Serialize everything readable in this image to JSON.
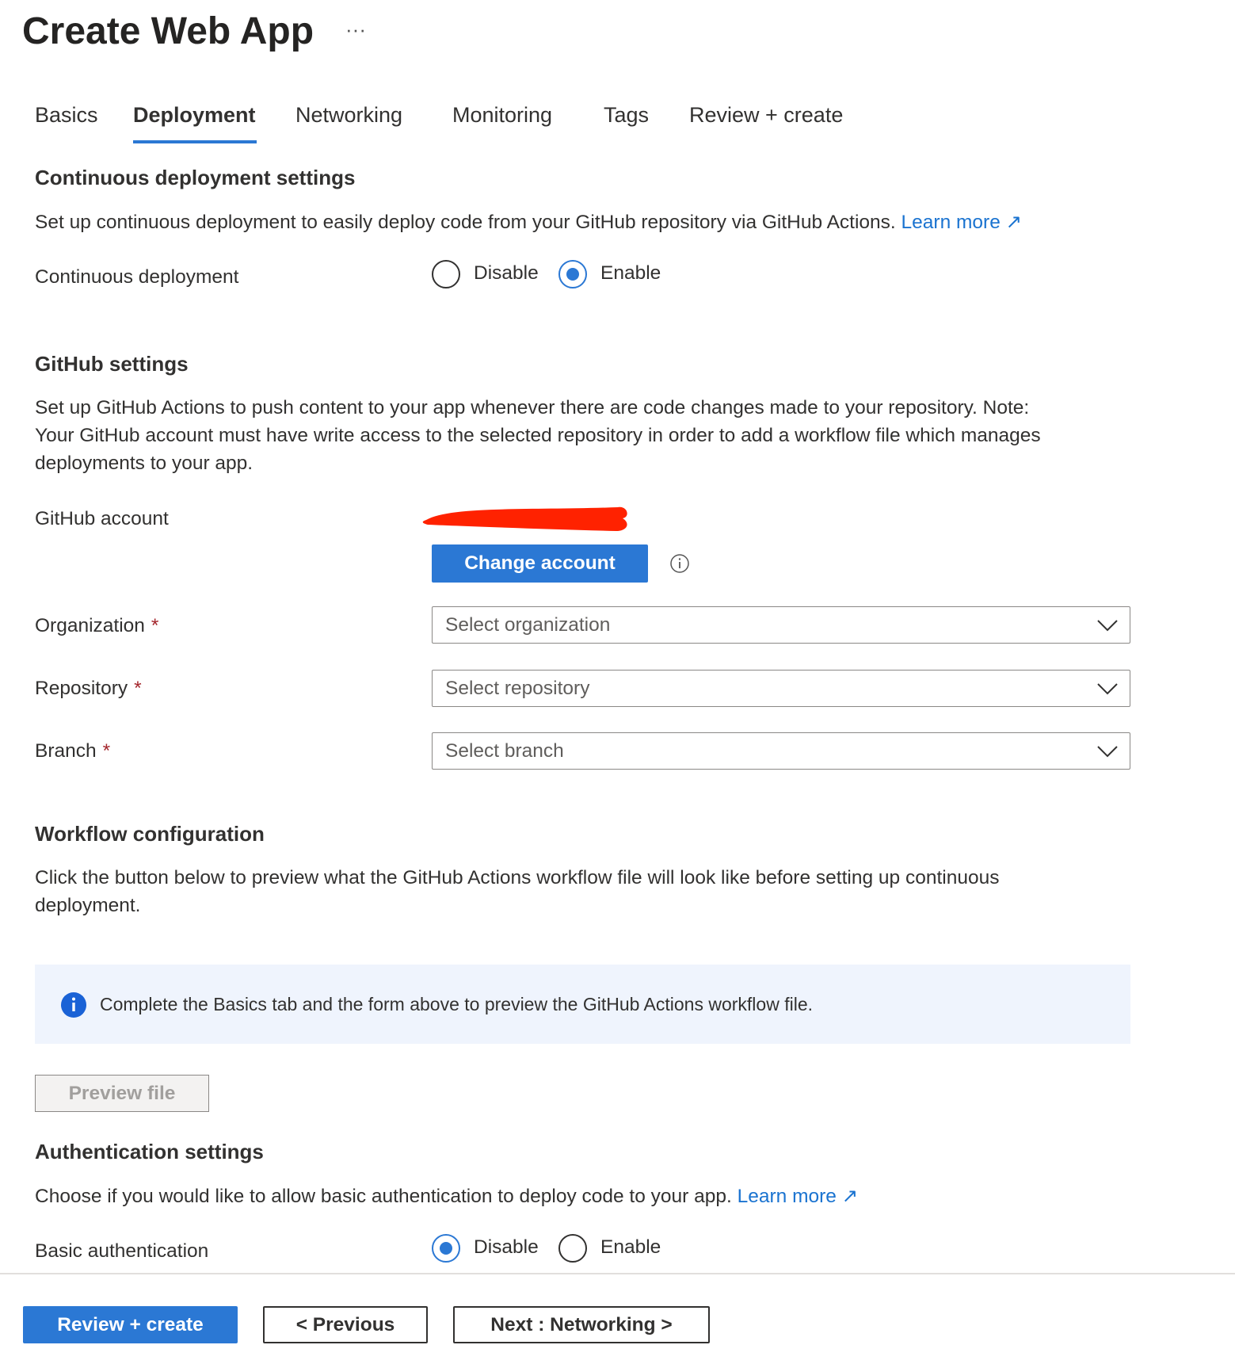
{
  "header": {
    "title": "Create Web App",
    "more": "···"
  },
  "tabs": [
    {
      "label": "Basics"
    },
    {
      "label": "Deployment"
    },
    {
      "label": "Networking"
    },
    {
      "label": "Monitoring"
    },
    {
      "label": "Tags"
    },
    {
      "label": "Review + create"
    }
  ],
  "cd": {
    "heading": "Continuous deployment settings",
    "description": "Set up continuous deployment to easily deploy code from your GitHub repository via GitHub Actions.",
    "learn_more": "Learn more",
    "label": "Continuous deployment",
    "options": [
      "Disable",
      "Enable"
    ],
    "selected": "Enable"
  },
  "github": {
    "heading": "GitHub settings",
    "description_lines": [
      "Set up GitHub Actions to push content to your app whenever there are code changes made to your repository. Note:",
      "Your GitHub account must have write access to the selected repository in order to add a workflow file which manages",
      "deployments to your app."
    ],
    "account_label": "GitHub account",
    "change_account": "Change account",
    "organization": {
      "label": "Organization",
      "placeholder": "Select organization"
    },
    "repository": {
      "label": "Repository",
      "placeholder": "Select repository"
    },
    "branch": {
      "label": "Branch",
      "placeholder": "Select branch"
    },
    "required": "*"
  },
  "workflow": {
    "heading": "Workflow configuration",
    "description_lines": [
      "Click the button below to preview what the GitHub Actions workflow file will look like before setting up continuous",
      "deployment."
    ],
    "info": "Complete the Basics tab and the form above to preview the GitHub Actions workflow file.",
    "preview": "Preview file"
  },
  "auth": {
    "heading": "Authentication settings",
    "description": "Choose if you would like to allow basic authentication to deploy code to your app.",
    "learn_more": "Learn more",
    "label": "Basic authentication",
    "options": [
      "Disable",
      "Enable"
    ],
    "selected": "Disable"
  },
  "footer": {
    "review": "Review + create",
    "previous": "< Previous",
    "next": "Next : Networking >"
  },
  "colors": {
    "accent": "#2b78d4",
    "redaction": "#ff2200",
    "info_bg": "#eff4fd"
  }
}
